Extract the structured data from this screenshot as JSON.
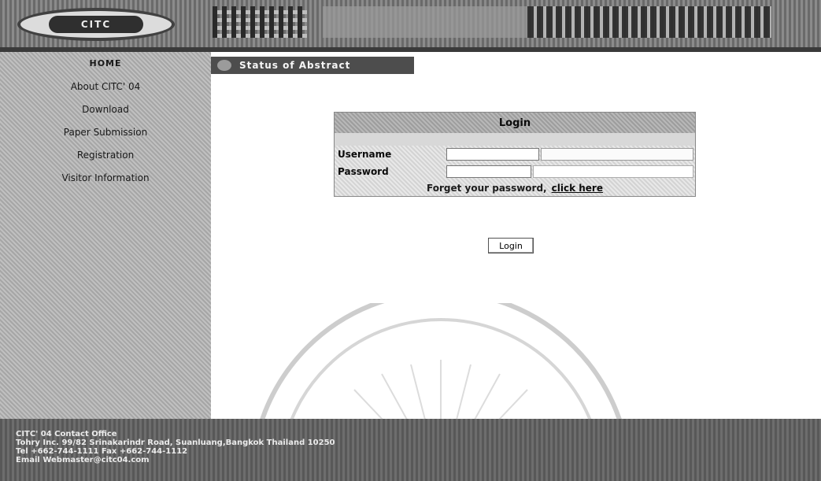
{
  "header": {
    "logo_text": "CITC"
  },
  "sidebar": {
    "items": [
      {
        "label": "HOME"
      },
      {
        "label": "About CITC' 04"
      },
      {
        "label": "Download"
      },
      {
        "label": "Paper Submission"
      },
      {
        "label": "Registration"
      },
      {
        "label": "Visitor Information"
      }
    ]
  },
  "section": {
    "title": "Status of Abstract"
  },
  "login": {
    "title": "Login",
    "username_label": "Username",
    "password_label": "Password",
    "username_value": "",
    "password_value": "",
    "forgot_text": "Forget your password,",
    "forgot_link": "click here",
    "button_label": "Login"
  },
  "footer": {
    "line1": "CITC' 04  Contact Office",
    "line2": "Tohry  Inc. 99/82 Srinakarindr Road, Suanluang,Bangkok Thailand 10250",
    "line3": "Tel   +662-744-1111     Fax   +662-744-1112",
    "line4": "Email    Webmaster@citc04.com"
  }
}
